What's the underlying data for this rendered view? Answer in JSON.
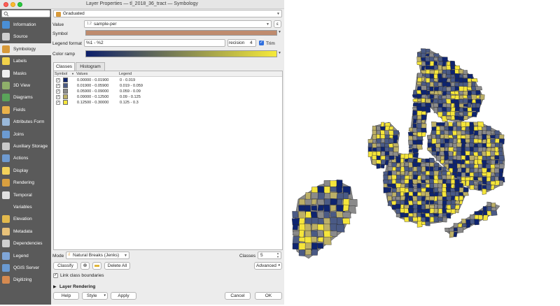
{
  "window": {
    "title": "Layer Properties — tl_2018_36_tract — Symbology"
  },
  "sidebar": {
    "items": [
      {
        "label": "Information",
        "icon": "info-icon",
        "color": "#4a8fd6"
      },
      {
        "label": "Source",
        "icon": "source-icon",
        "color": "#cfcfcf"
      },
      {
        "label": "Symbology",
        "icon": "paintbrush-icon",
        "color": "#d89a3a"
      },
      {
        "label": "Labels",
        "icon": "labels-icon",
        "color": "#f1d24a"
      },
      {
        "label": "Masks",
        "icon": "masks-icon",
        "color": "#efefef"
      },
      {
        "label": "3D View",
        "icon": "cube-icon",
        "color": "#8fb06a"
      },
      {
        "label": "Diagrams",
        "icon": "diagram-icon",
        "color": "#5aa35a"
      },
      {
        "label": "Fields",
        "icon": "fields-icon",
        "color": "#e9b24a"
      },
      {
        "label": "Attributes Form",
        "icon": "form-icon",
        "color": "#9ab8d8"
      },
      {
        "label": "Joins",
        "icon": "joins-icon",
        "color": "#6c9bd2"
      },
      {
        "label": "Auxiliary Storage",
        "icon": "storage-icon",
        "color": "#c9c9c9"
      },
      {
        "label": "Actions",
        "icon": "actions-icon",
        "color": "#6e9ad0"
      },
      {
        "label": "Display",
        "icon": "display-icon",
        "color": "#f3d25b"
      },
      {
        "label": "Rendering",
        "icon": "rendering-icon",
        "color": "#d9a040"
      },
      {
        "label": "Temporal",
        "icon": "clock-icon",
        "color": "#e0e0e0"
      },
      {
        "label": "Variables",
        "icon": "variables-icon",
        "color": "#5a5a5a"
      },
      {
        "label": "Elevation",
        "icon": "elevation-icon",
        "color": "#e3b94c"
      },
      {
        "label": "Metadata",
        "icon": "metadata-icon",
        "color": "#e8c27a"
      },
      {
        "label": "Dependencies",
        "icon": "dependencies-icon",
        "color": "#cfcfcf"
      },
      {
        "label": "Legend",
        "icon": "legend-icon",
        "color": "#7fa6d8"
      },
      {
        "label": "QGIS Server",
        "icon": "server-icon",
        "color": "#6a9ad2"
      },
      {
        "label": "Digitizing",
        "icon": "digitizing-icon",
        "color": "#d58a50"
      }
    ],
    "active_index": 2
  },
  "symbology": {
    "renderer": "Graduated",
    "value_label": "Value",
    "value_field": "sample-per",
    "symbol_label": "Symbol",
    "symbol_color": "#bf8b6e",
    "legend_format_label": "Legend format",
    "legend_format_value": "%1 - %2",
    "precision_label": "recision",
    "precision_value": "4",
    "trim_label": "Trim",
    "color_ramp_label": "Color ramp",
    "ramp_from": "#0c1f6b",
    "ramp_to": "#f6ea3a"
  },
  "tabs": [
    {
      "label": "Classes",
      "active": true
    },
    {
      "label": "Histogram",
      "active": false
    }
  ],
  "table": {
    "columns": [
      "Symbol",
      "Values",
      "Legend"
    ],
    "rows": [
      {
        "color": "#0e2470",
        "values": "0.00000 - 0.01900",
        "legend": "0 - 0.019"
      },
      {
        "color": "#4a5a85",
        "values": "0.01900 - 0.05900",
        "legend": "0.019 - 0.059"
      },
      {
        "color": "#8a8a8a",
        "values": "0.05900 - 0.09000",
        "legend": "0.059 - 0.09"
      },
      {
        "color": "#bdb067",
        "values": "0.09000 - 0.12500",
        "legend": "0.09 - 0.125"
      },
      {
        "color": "#f5e53b",
        "values": "0.12500 - 0.30000",
        "legend": "0.125 - 0.3"
      }
    ]
  },
  "mode": {
    "label": "Mode",
    "value": "Natural Breaks (Jenks)",
    "classes_label": "Classes",
    "classes_value": "5"
  },
  "buttons": {
    "classify": "Classify",
    "delete_all": "Delete All",
    "advanced": "Advanced",
    "link_boundaries": "Link class boundaries",
    "layer_rendering": "Layer Rendering",
    "help": "Help",
    "style": "Style",
    "apply": "Apply",
    "cancel": "Cancel",
    "ok": "OK"
  },
  "map": {
    "palette": [
      "#0e2470",
      "#4a5a85",
      "#8a8a8a",
      "#bdb067",
      "#f5e53b"
    ]
  }
}
